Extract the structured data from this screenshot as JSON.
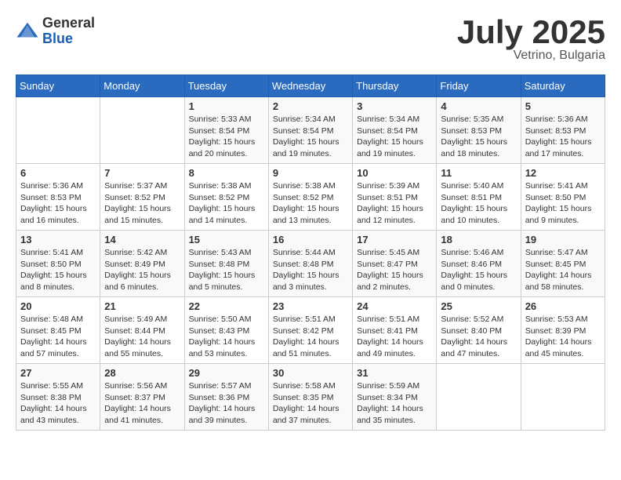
{
  "logo": {
    "general": "General",
    "blue": "Blue"
  },
  "header": {
    "month": "July 2025",
    "location": "Vetrino, Bulgaria"
  },
  "weekdays": [
    "Sunday",
    "Monday",
    "Tuesday",
    "Wednesday",
    "Thursday",
    "Friday",
    "Saturday"
  ],
  "weeks": [
    [
      {
        "day": "",
        "info": ""
      },
      {
        "day": "",
        "info": ""
      },
      {
        "day": "1",
        "info": "Sunrise: 5:33 AM\nSunset: 8:54 PM\nDaylight: 15 hours and 20 minutes."
      },
      {
        "day": "2",
        "info": "Sunrise: 5:34 AM\nSunset: 8:54 PM\nDaylight: 15 hours and 19 minutes."
      },
      {
        "day": "3",
        "info": "Sunrise: 5:34 AM\nSunset: 8:54 PM\nDaylight: 15 hours and 19 minutes."
      },
      {
        "day": "4",
        "info": "Sunrise: 5:35 AM\nSunset: 8:53 PM\nDaylight: 15 hours and 18 minutes."
      },
      {
        "day": "5",
        "info": "Sunrise: 5:36 AM\nSunset: 8:53 PM\nDaylight: 15 hours and 17 minutes."
      }
    ],
    [
      {
        "day": "6",
        "info": "Sunrise: 5:36 AM\nSunset: 8:53 PM\nDaylight: 15 hours and 16 minutes."
      },
      {
        "day": "7",
        "info": "Sunrise: 5:37 AM\nSunset: 8:52 PM\nDaylight: 15 hours and 15 minutes."
      },
      {
        "day": "8",
        "info": "Sunrise: 5:38 AM\nSunset: 8:52 PM\nDaylight: 15 hours and 14 minutes."
      },
      {
        "day": "9",
        "info": "Sunrise: 5:38 AM\nSunset: 8:52 PM\nDaylight: 15 hours and 13 minutes."
      },
      {
        "day": "10",
        "info": "Sunrise: 5:39 AM\nSunset: 8:51 PM\nDaylight: 15 hours and 12 minutes."
      },
      {
        "day": "11",
        "info": "Sunrise: 5:40 AM\nSunset: 8:51 PM\nDaylight: 15 hours and 10 minutes."
      },
      {
        "day": "12",
        "info": "Sunrise: 5:41 AM\nSunset: 8:50 PM\nDaylight: 15 hours and 9 minutes."
      }
    ],
    [
      {
        "day": "13",
        "info": "Sunrise: 5:41 AM\nSunset: 8:50 PM\nDaylight: 15 hours and 8 minutes."
      },
      {
        "day": "14",
        "info": "Sunrise: 5:42 AM\nSunset: 8:49 PM\nDaylight: 15 hours and 6 minutes."
      },
      {
        "day": "15",
        "info": "Sunrise: 5:43 AM\nSunset: 8:48 PM\nDaylight: 15 hours and 5 minutes."
      },
      {
        "day": "16",
        "info": "Sunrise: 5:44 AM\nSunset: 8:48 PM\nDaylight: 15 hours and 3 minutes."
      },
      {
        "day": "17",
        "info": "Sunrise: 5:45 AM\nSunset: 8:47 PM\nDaylight: 15 hours and 2 minutes."
      },
      {
        "day": "18",
        "info": "Sunrise: 5:46 AM\nSunset: 8:46 PM\nDaylight: 15 hours and 0 minutes."
      },
      {
        "day": "19",
        "info": "Sunrise: 5:47 AM\nSunset: 8:45 PM\nDaylight: 14 hours and 58 minutes."
      }
    ],
    [
      {
        "day": "20",
        "info": "Sunrise: 5:48 AM\nSunset: 8:45 PM\nDaylight: 14 hours and 57 minutes."
      },
      {
        "day": "21",
        "info": "Sunrise: 5:49 AM\nSunset: 8:44 PM\nDaylight: 14 hours and 55 minutes."
      },
      {
        "day": "22",
        "info": "Sunrise: 5:50 AM\nSunset: 8:43 PM\nDaylight: 14 hours and 53 minutes."
      },
      {
        "day": "23",
        "info": "Sunrise: 5:51 AM\nSunset: 8:42 PM\nDaylight: 14 hours and 51 minutes."
      },
      {
        "day": "24",
        "info": "Sunrise: 5:51 AM\nSunset: 8:41 PM\nDaylight: 14 hours and 49 minutes."
      },
      {
        "day": "25",
        "info": "Sunrise: 5:52 AM\nSunset: 8:40 PM\nDaylight: 14 hours and 47 minutes."
      },
      {
        "day": "26",
        "info": "Sunrise: 5:53 AM\nSunset: 8:39 PM\nDaylight: 14 hours and 45 minutes."
      }
    ],
    [
      {
        "day": "27",
        "info": "Sunrise: 5:55 AM\nSunset: 8:38 PM\nDaylight: 14 hours and 43 minutes."
      },
      {
        "day": "28",
        "info": "Sunrise: 5:56 AM\nSunset: 8:37 PM\nDaylight: 14 hours and 41 minutes."
      },
      {
        "day": "29",
        "info": "Sunrise: 5:57 AM\nSunset: 8:36 PM\nDaylight: 14 hours and 39 minutes."
      },
      {
        "day": "30",
        "info": "Sunrise: 5:58 AM\nSunset: 8:35 PM\nDaylight: 14 hours and 37 minutes."
      },
      {
        "day": "31",
        "info": "Sunrise: 5:59 AM\nSunset: 8:34 PM\nDaylight: 14 hours and 35 minutes."
      },
      {
        "day": "",
        "info": ""
      },
      {
        "day": "",
        "info": ""
      }
    ]
  ]
}
